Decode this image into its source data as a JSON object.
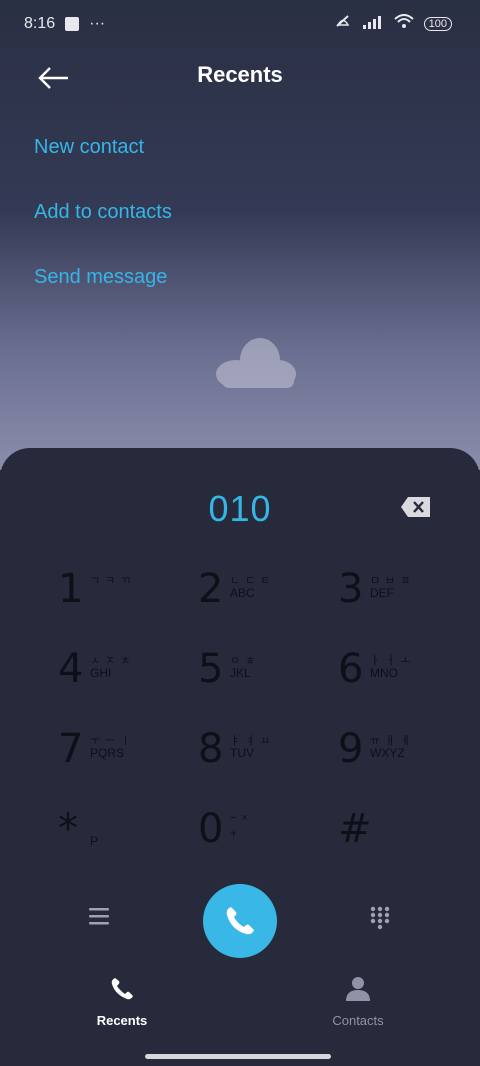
{
  "status_bar": {
    "time": "8:16",
    "dots": "···",
    "battery": "100"
  },
  "header": {
    "title": "Recents"
  },
  "actions": {
    "new_contact": "New contact",
    "add_to_contacts": "Add to contacts",
    "send_message": "Send message"
  },
  "dialer": {
    "number": "010",
    "keys": [
      {
        "digit": "1",
        "sub1": "ㄱ ㅋ ㄲ",
        "sub2": ""
      },
      {
        "digit": "2",
        "sub1": "ㄴ ㄷ ㅌ",
        "sub2": "ABC"
      },
      {
        "digit": "3",
        "sub1": "ㅁ ㅂ ㅍ",
        "sub2": "DEF"
      },
      {
        "digit": "4",
        "sub1": "ㅅ ㅈ ㅊ",
        "sub2": "GHI"
      },
      {
        "digit": "5",
        "sub1": "ㅇ ㅎ",
        "sub2": "JKL"
      },
      {
        "digit": "6",
        "sub1": "ㅏ ㅓ ㅗ",
        "sub2": "MNO"
      },
      {
        "digit": "7",
        "sub1": "ㅜ ㅡ ㅣ",
        "sub2": "PQRS"
      },
      {
        "digit": "8",
        "sub1": "ㅑ ㅕ ㅛ",
        "sub2": "TUV"
      },
      {
        "digit": "9",
        "sub1": "ㅠ ㅐ ㅔ",
        "sub2": "WXYZ"
      },
      {
        "digit": "*",
        "sub1": "",
        "sub2": "P"
      },
      {
        "digit": "0",
        "sub1": "− ×",
        "sub2": "+"
      },
      {
        "digit": "#",
        "sub1": "",
        "sub2": ""
      }
    ]
  },
  "tabs": {
    "recents": "Recents",
    "contacts": "Contacts"
  },
  "colors": {
    "accent": "#35b6e6",
    "sheet": "#262a3a"
  }
}
